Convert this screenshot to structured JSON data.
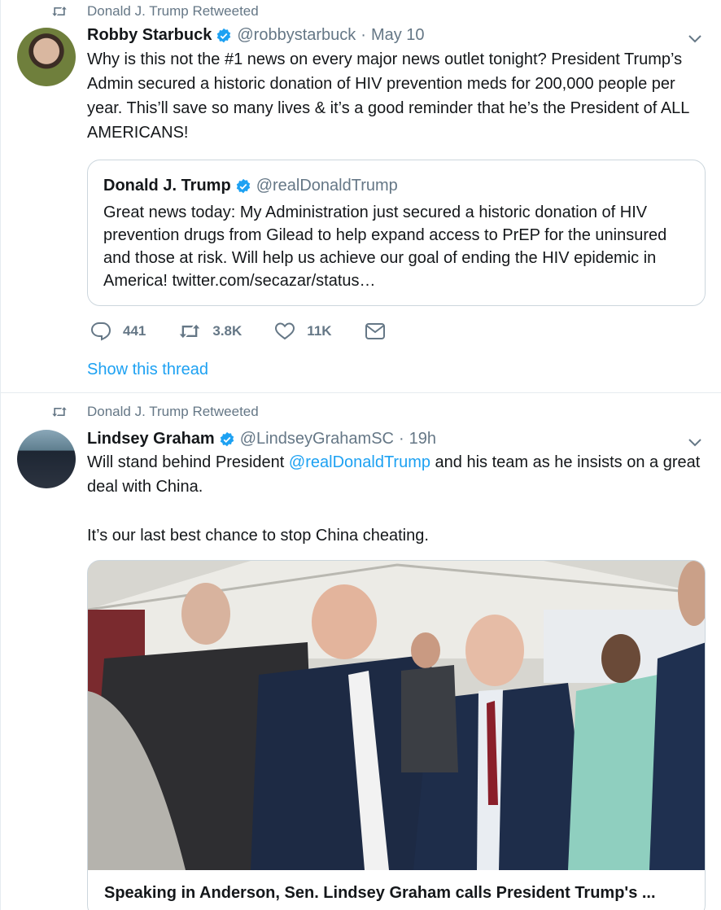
{
  "tweets": [
    {
      "context": "Donald J. Trump Retweeted",
      "name": "Robby Starbuck",
      "handle": "@robbystarbuck",
      "time": "May 10",
      "text": "Why is this not the #1 news on every major news outlet tonight? President Trump’s Admin secured a historic donation of HIV prevention meds for 200,000 people per year. This’ll save so many lives & it’s a good reminder that he’s the President of ALL AMERICANS!",
      "quote": {
        "name": "Donald J. Trump",
        "handle": "@realDonaldTrump",
        "text": "Great news today: My Administration just secured a historic donation of HIV prevention drugs from Gilead to help expand access to PrEP for the uninsured and those at risk. Will help us achieve our goal of ending the HIV epidemic in America! twitter.com/secazar/status…"
      },
      "replies": "441",
      "retweets": "3.8K",
      "likes": "11K",
      "show_thread": "Show this thread"
    },
    {
      "context": "Donald J. Trump Retweeted",
      "name": "Lindsey Graham",
      "handle": "@LindseyGrahamSC",
      "time": "19h",
      "text_before": "Will stand behind President ",
      "mention": "@realDonaldTrump",
      "text_after": " and his team as he insists on a great deal with China.\n\nIt’s our last best chance to stop China cheating.",
      "card_title": "Speaking in Anderson, Sen. Lindsey Graham calls President Trump's ..."
    }
  ],
  "colors": {
    "accent": "#1da1f2",
    "secondary_text": "#657786",
    "border": "#e6ecf0"
  },
  "icons": [
    "retweet-icon",
    "verified-badge-icon",
    "chevron-down-icon",
    "reply-icon",
    "heart-icon",
    "message-icon"
  ]
}
